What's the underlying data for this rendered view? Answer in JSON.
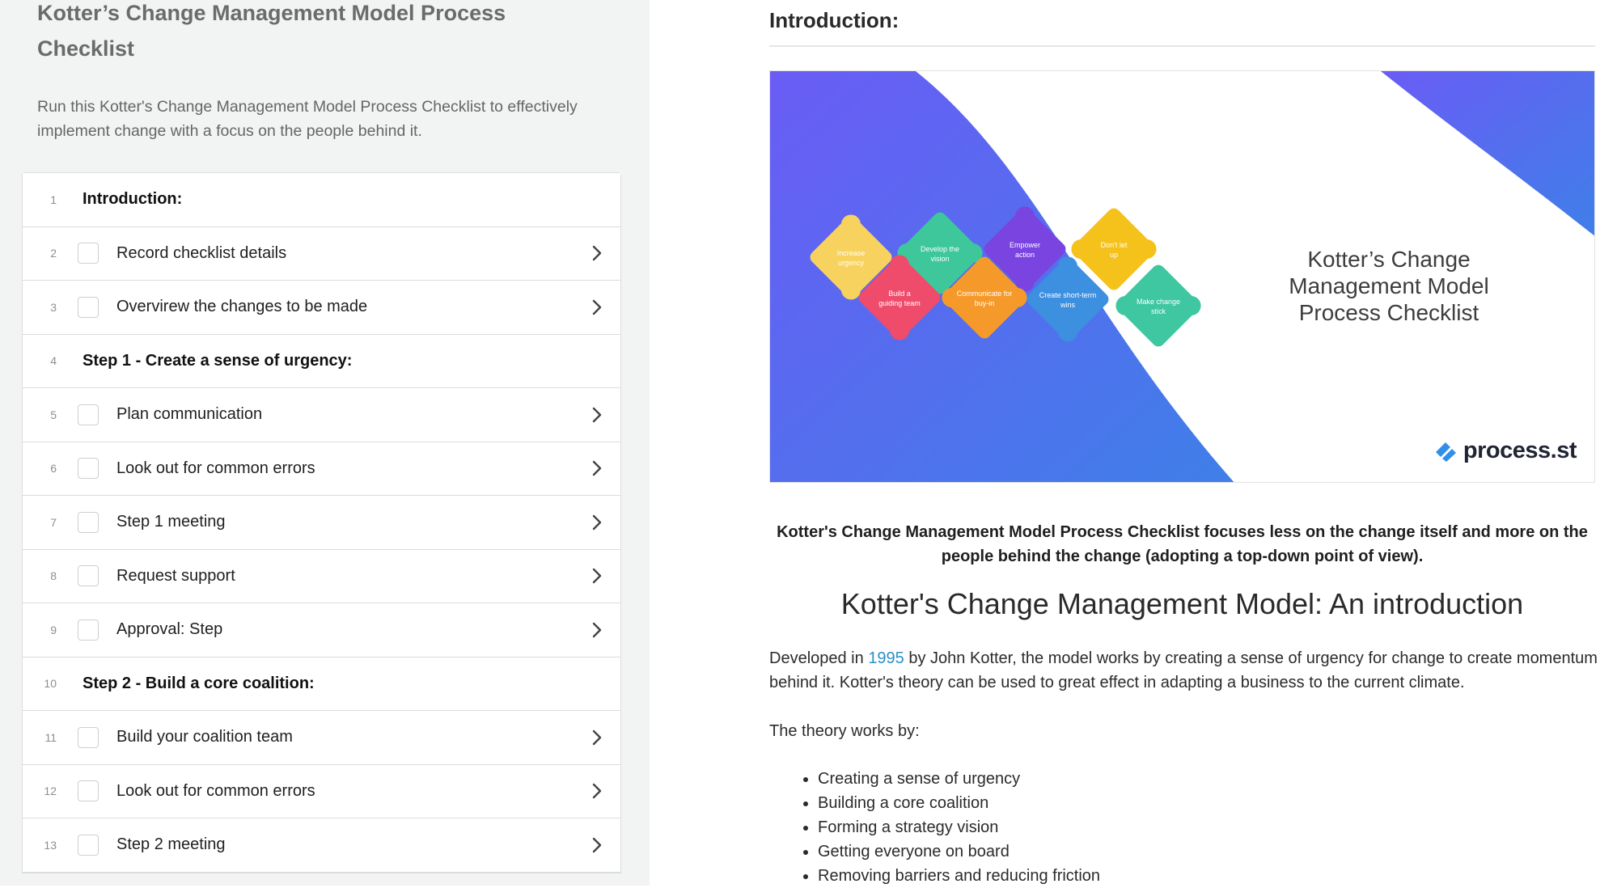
{
  "sidebar": {
    "title": "Kotter’s Change Management Model Process Checklist",
    "description": "Run this Kotter's Change Management Model Process Checklist to effectively implement change with a focus on the people behind it.",
    "rows": [
      {
        "num": "1",
        "label": "Introduction:",
        "type": "heading"
      },
      {
        "num": "2",
        "label": "Record checklist details",
        "type": "task"
      },
      {
        "num": "3",
        "label": "Overvirew the changes to be made",
        "type": "task"
      },
      {
        "num": "4",
        "label": "Step 1 - Create a sense of urgency:",
        "type": "heading"
      },
      {
        "num": "5",
        "label": "Plan communication",
        "type": "task"
      },
      {
        "num": "6",
        "label": "Look out for common errors",
        "type": "task"
      },
      {
        "num": "7",
        "label": "Step 1 meeting",
        "type": "task"
      },
      {
        "num": "8",
        "label": "Request support",
        "type": "task"
      },
      {
        "num": "9",
        "label": "Approval: Step",
        "type": "task"
      },
      {
        "num": "10",
        "label": "Step 2 - Build a core coalition:",
        "type": "heading"
      },
      {
        "num": "11",
        "label": "Build your coalition team",
        "type": "task"
      },
      {
        "num": "12",
        "label": "Look out for common errors",
        "type": "task"
      },
      {
        "num": "13",
        "label": "Step 2 meeting",
        "type": "task"
      }
    ]
  },
  "main": {
    "section_title": "Introduction:",
    "banner": {
      "title": "Kotter’s Change Management Model Process Checklist",
      "brand": "process.st",
      "puzzle_labels": [
        "Increase urgency",
        "Develop the vision",
        "Empower action",
        "Don't let up",
        "Build a guiding team",
        "Communicate for buy-in",
        "Create short-term wins",
        "Make change stick"
      ],
      "puzzle_colors": [
        "#f7d25e",
        "#3ec79a",
        "#7a44e0",
        "#f5c21b",
        "#ef4b6b",
        "#f59a2a",
        "#3d8fe0",
        "#3ec7a1"
      ],
      "gradient": [
        "#6a5cf5",
        "#3f7fe8"
      ]
    },
    "lead": "Kotter's Change Management Model Process Checklist focuses less on the change itself and more on the people behind the change (adopting a top-down point of view).",
    "heading": "Kotter's Change Management Model: An introduction",
    "paragraph": {
      "before": "Developed in ",
      "link": "1995",
      "after": " by John Kotter, the model works by creating a sense of urgency for change to create momentum behind it. Kotter's theory can be used to great effect in adapting a business to the current climate."
    },
    "theory_intro": "The theory works by:",
    "bullets": [
      "Creating a sense of urgency",
      "Building a core coalition",
      "Forming a strategy vision",
      "Getting everyone on board",
      "Removing barriers and reducing friction"
    ]
  }
}
